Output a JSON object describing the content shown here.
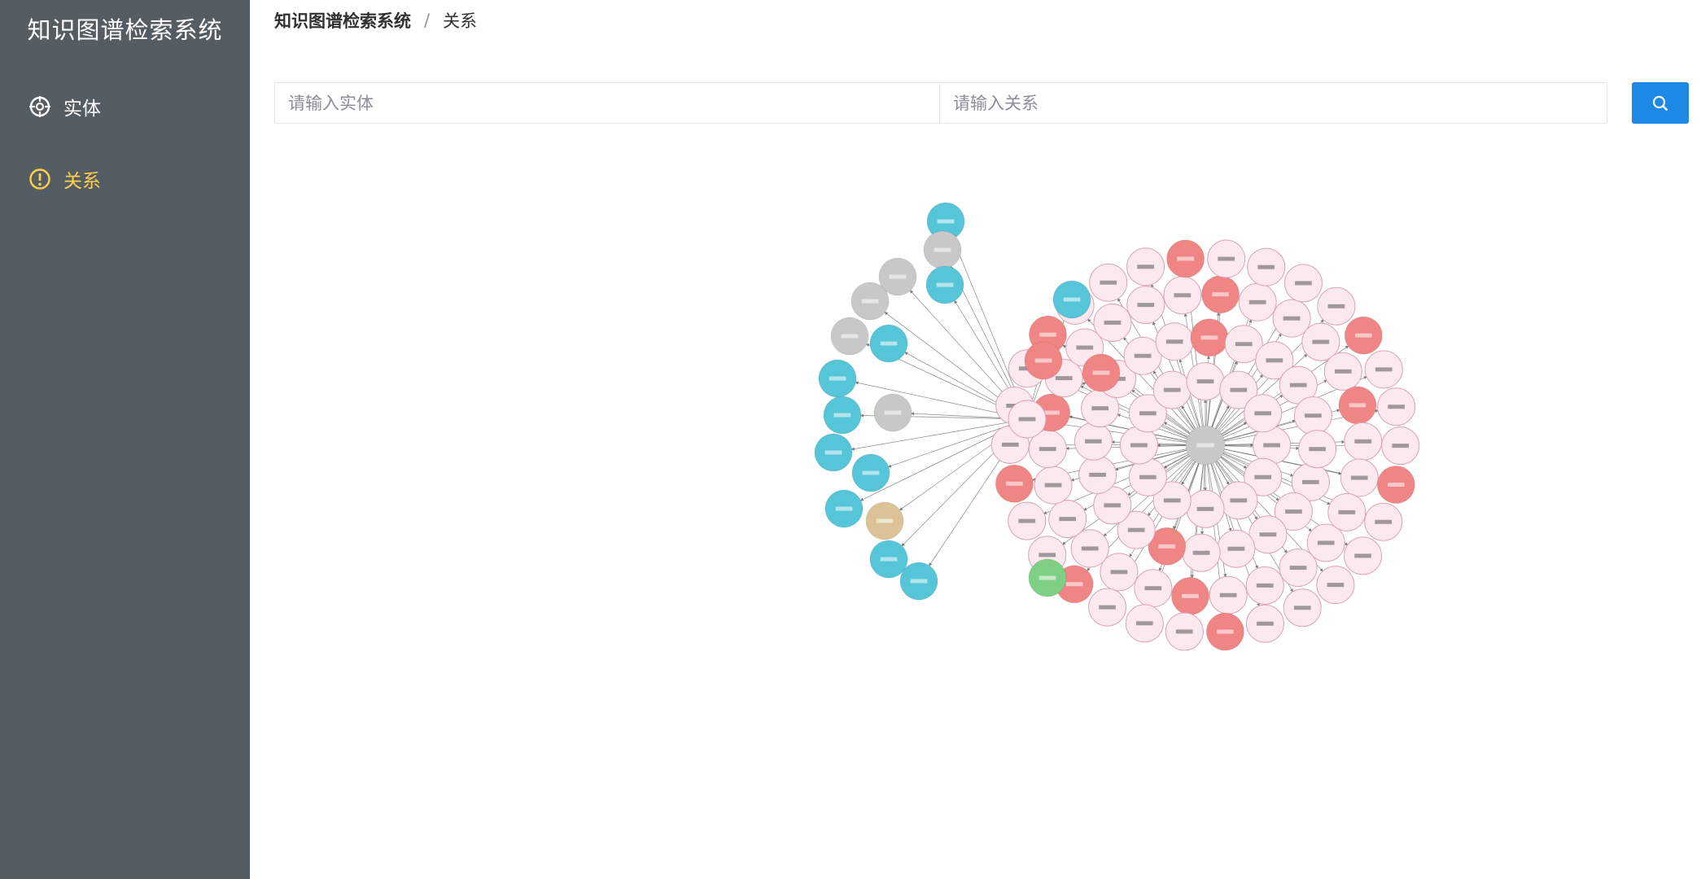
{
  "sidebar": {
    "title": "知识图谱检索系统",
    "items": [
      {
        "label": "实体",
        "icon": "crosshair-icon",
        "active": false
      },
      {
        "label": "关系",
        "icon": "info-circle-icon",
        "active": true
      }
    ],
    "background": "#545c64",
    "active_color": "#ffd04b"
  },
  "breadcrumb": {
    "root": "知识图谱检索系统",
    "separator": "/",
    "current": "关系"
  },
  "search": {
    "entity_placeholder": "请输入实体",
    "relation_placeholder": "请输入关系",
    "button_icon": "search-icon",
    "button_color": "#1e88e5"
  },
  "graph": {
    "colors": {
      "pink": "#fce8ef",
      "red": "#f08585",
      "cyan": "#56c5d8",
      "gray": "#c8c8c8",
      "tan": "#dcc397",
      "green": "#7fcf85"
    }
  }
}
